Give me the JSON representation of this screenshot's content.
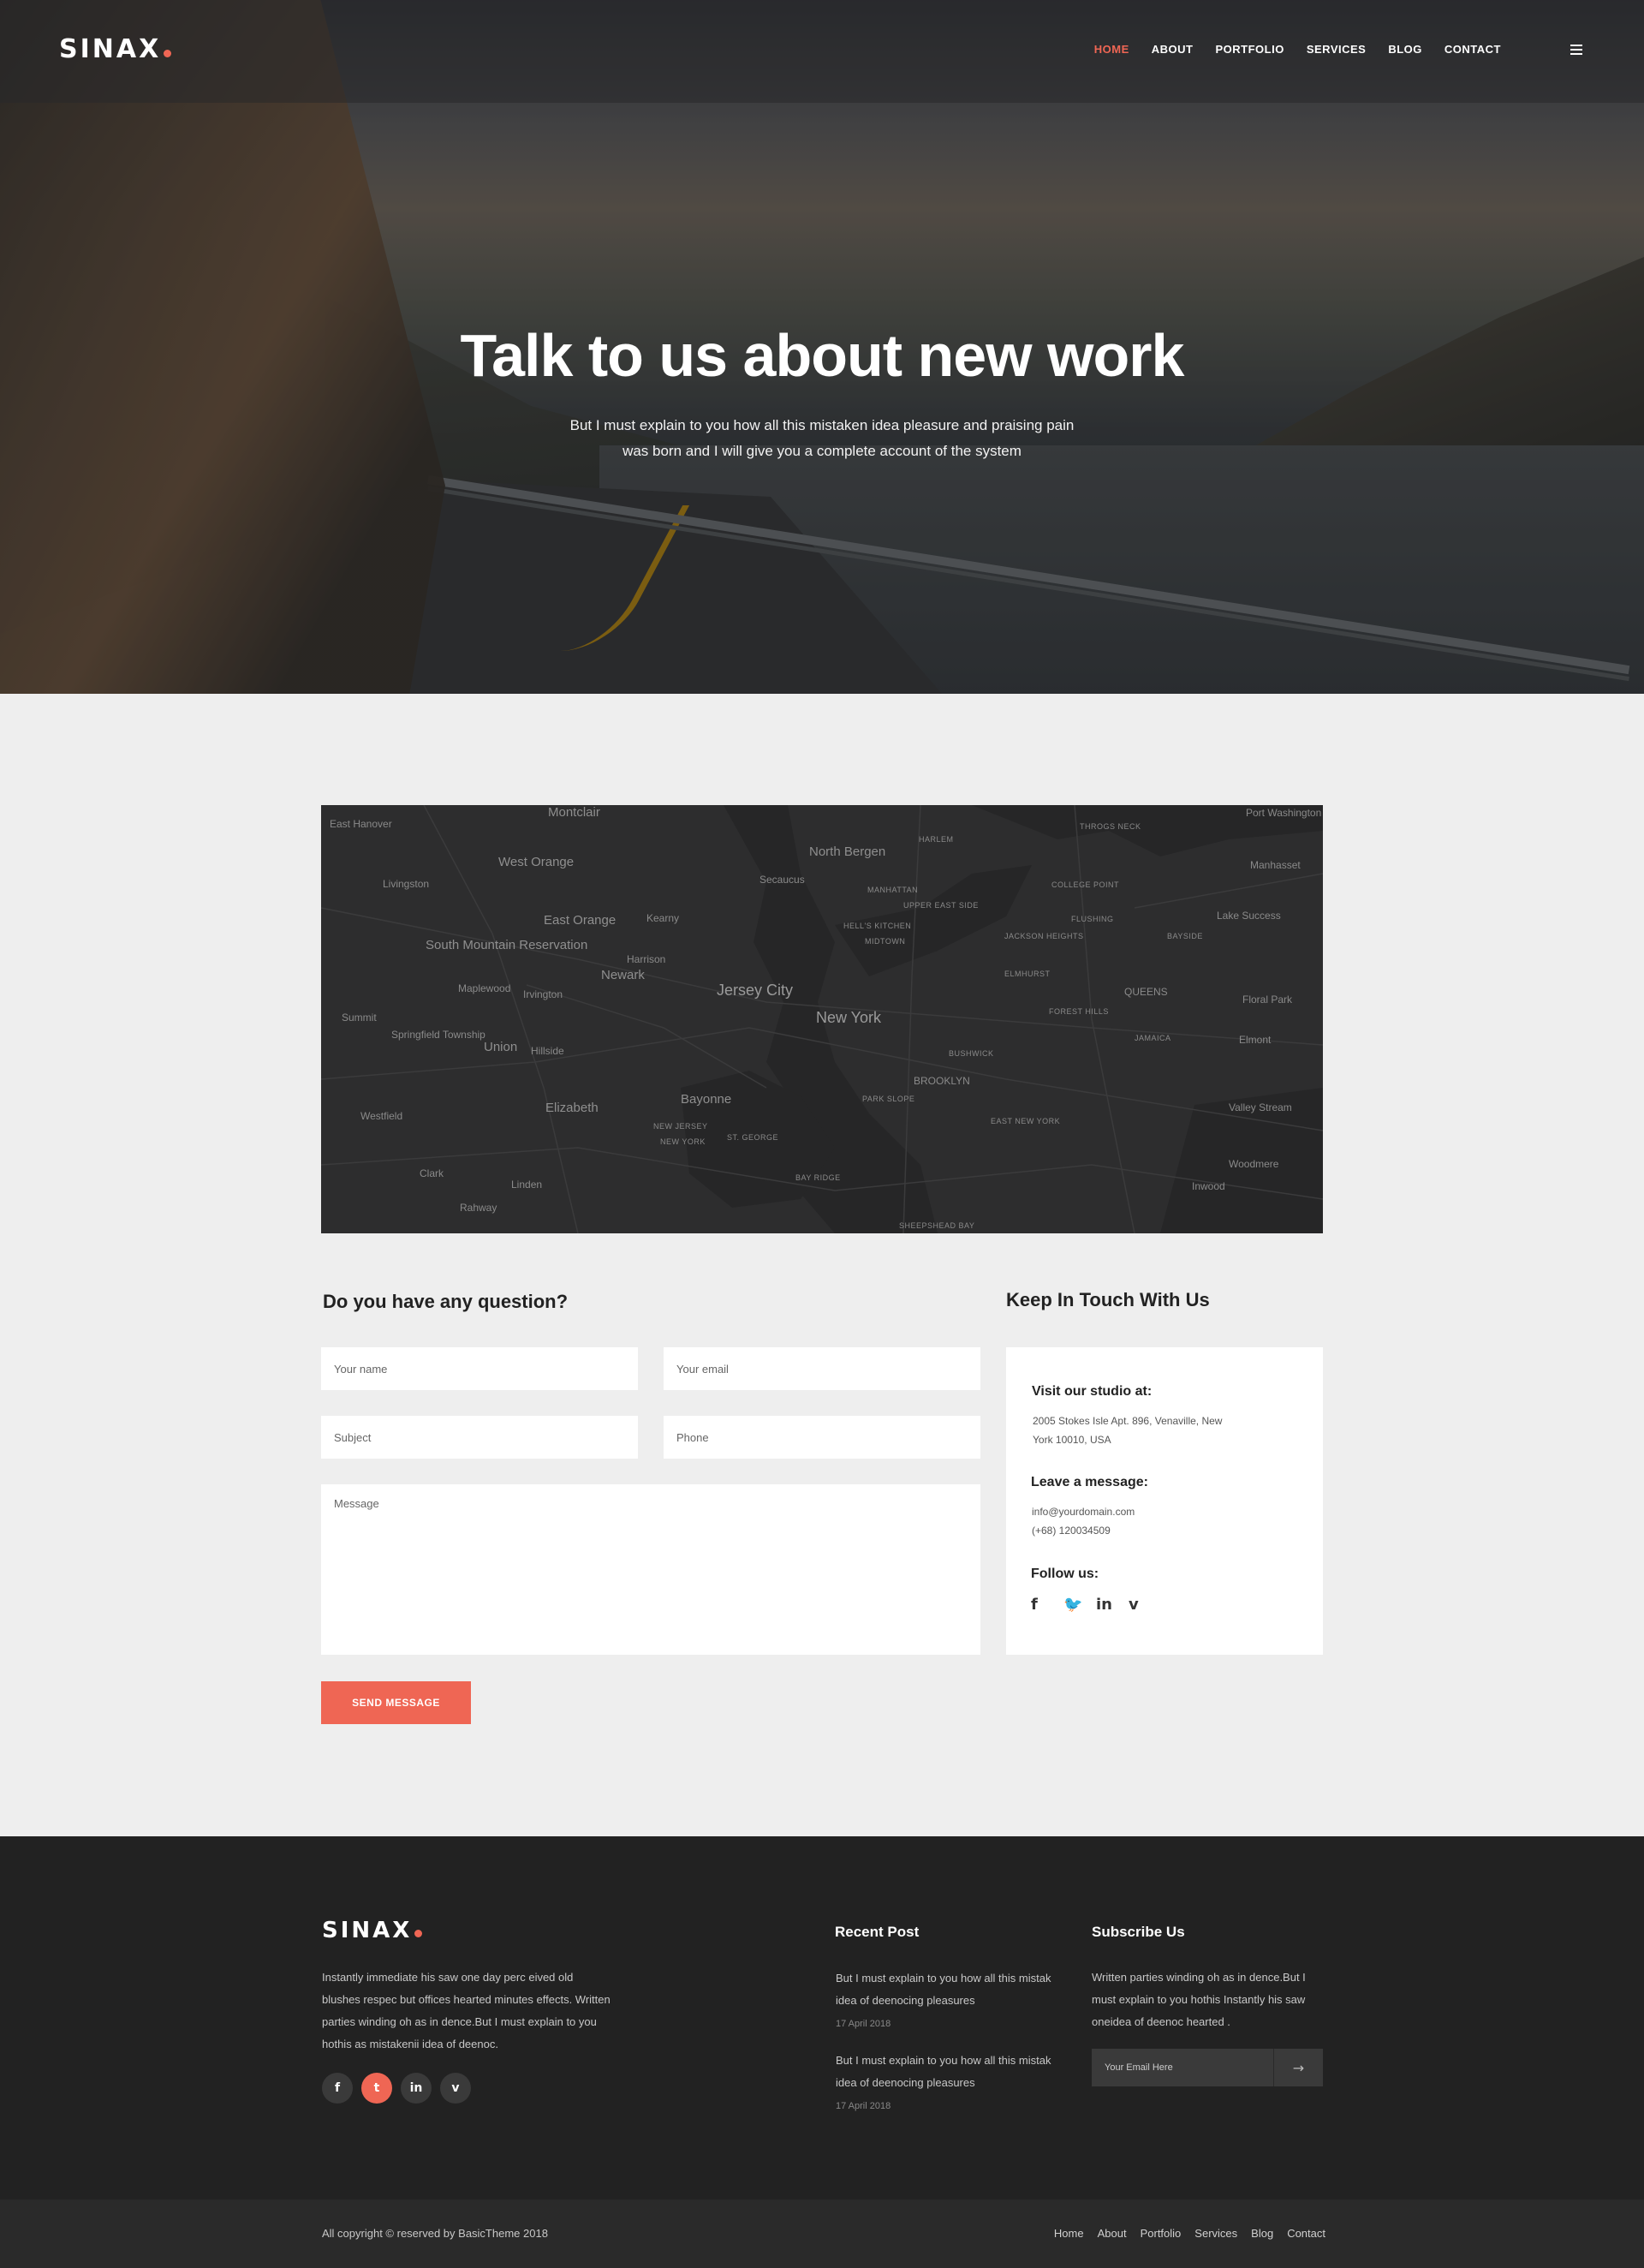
{
  "brand": {
    "logo": "SINAX",
    "accent": "#ef6654"
  },
  "nav": {
    "items": [
      "HOME",
      "ABOUT",
      "PORTFOLIO",
      "SERVICES",
      "BLOG",
      "CONTACT"
    ],
    "active": "HOME",
    "menu_icon": "hamburger-icon"
  },
  "hero": {
    "title": "Talk to us about new work",
    "subtitle": "But I must explain to you how all this mistaken idea pleasure and praising pain was born and I will give you a complete account of the system"
  },
  "map": {
    "labels": [
      "East Hanover",
      "Montclair",
      "West Orange",
      "North Bergen",
      "HARLEM",
      "THROGS NECK",
      "Port Washington",
      "Manhasset",
      "Livingston",
      "Secaucus",
      "MANHATTAN",
      "COLLEGE POINT",
      "East Orange",
      "Kearny",
      "UPPER EAST SIDE",
      "FLUSHING",
      "Lake Success",
      "South Mountain Reservation",
      "Harrison",
      "HELL'S KITCHEN",
      "MIDTOWN",
      "JACKSON HEIGHTS",
      "BAYSIDE",
      "Newark",
      "Jersey City",
      "ELMHURST",
      "Maplewood",
      "Irvington",
      "QUEENS",
      "Floral Park",
      "Summit",
      "FOREST HILLS",
      "Springfield Township",
      "Union",
      "Hillside",
      "New York",
      "JAMAICA",
      "Elmont",
      "BUSHWICK",
      "BROOKLYN",
      "Westfield",
      "Elizabeth",
      "Bayonne",
      "PARK SLOPE",
      "Valley Stream",
      "NEW JERSEY",
      "EAST NEW YORK",
      "NEW YORK",
      "ST. GEORGE",
      "Clark",
      "Linden",
      "BAY RIDGE",
      "Woodmere",
      "Rahway",
      "Inwood",
      "SHEEPSHEAD BAY"
    ]
  },
  "contact": {
    "form_title": "Do you have any question?",
    "name_placeholder": "Your name",
    "email_placeholder": "Your email",
    "subject_placeholder": "Subject",
    "phone_placeholder": "Phone",
    "message_placeholder": "Message",
    "send_label": "SEND MESSAGE"
  },
  "keep_in_touch": {
    "title": "Keep In Touch With Us",
    "visit_heading": "Visit our studio at:",
    "address_line1": "2005 Stokes Isle Apt. 896, Venaville, New",
    "address_line2": "York 10010, USA",
    "message_heading": "Leave a message:",
    "email": "info@yourdomain.com",
    "phone": "(+68) 120034509",
    "follow_heading": "Follow us:",
    "social_icons": [
      "facebook-icon",
      "twitter-icon",
      "linkedin-icon",
      "vimeo-icon"
    ]
  },
  "footer": {
    "logo": "SINAX",
    "about_text": "Instantly immediate his saw one day perc eived old blushes respec but offices hearted minutes effects. Written parties winding oh as in dence.But I must explain to you hothis as mistakenii idea of deenoc.",
    "social_icons": [
      "facebook-icon",
      "twitter-icon",
      "linkedin-icon",
      "vimeo-icon"
    ],
    "social_glyphs": [
      "f",
      "t",
      "in",
      "v"
    ],
    "recent_heading": "Recent Post",
    "posts": [
      {
        "title_line1": "But I must explain to you how all this mistak",
        "title_line2": "idea of deenocing pleasures",
        "date": "17 April 2018"
      },
      {
        "title_line1": "But I must explain to you how all this mistak",
        "title_line2": "idea of deenocing pleasures",
        "date": "17 April 2018"
      }
    ],
    "subscribe_heading": "Subscribe Us",
    "subscribe_text": "Written parties winding oh as in dence.But I must explain to you hothis Instantly his saw oneidea of deenoc hearted .",
    "subscribe_placeholder": "Your Email Here",
    "subscribe_button_icon": "arrow-right-icon",
    "subscribe_button_glyph": "→"
  },
  "bottom_bar": {
    "copyright": "All copyright © reserved by BasicTheme 2018",
    "links": [
      "Home",
      "About",
      "Portfolio",
      "Services",
      "Blog",
      "Contact"
    ]
  }
}
